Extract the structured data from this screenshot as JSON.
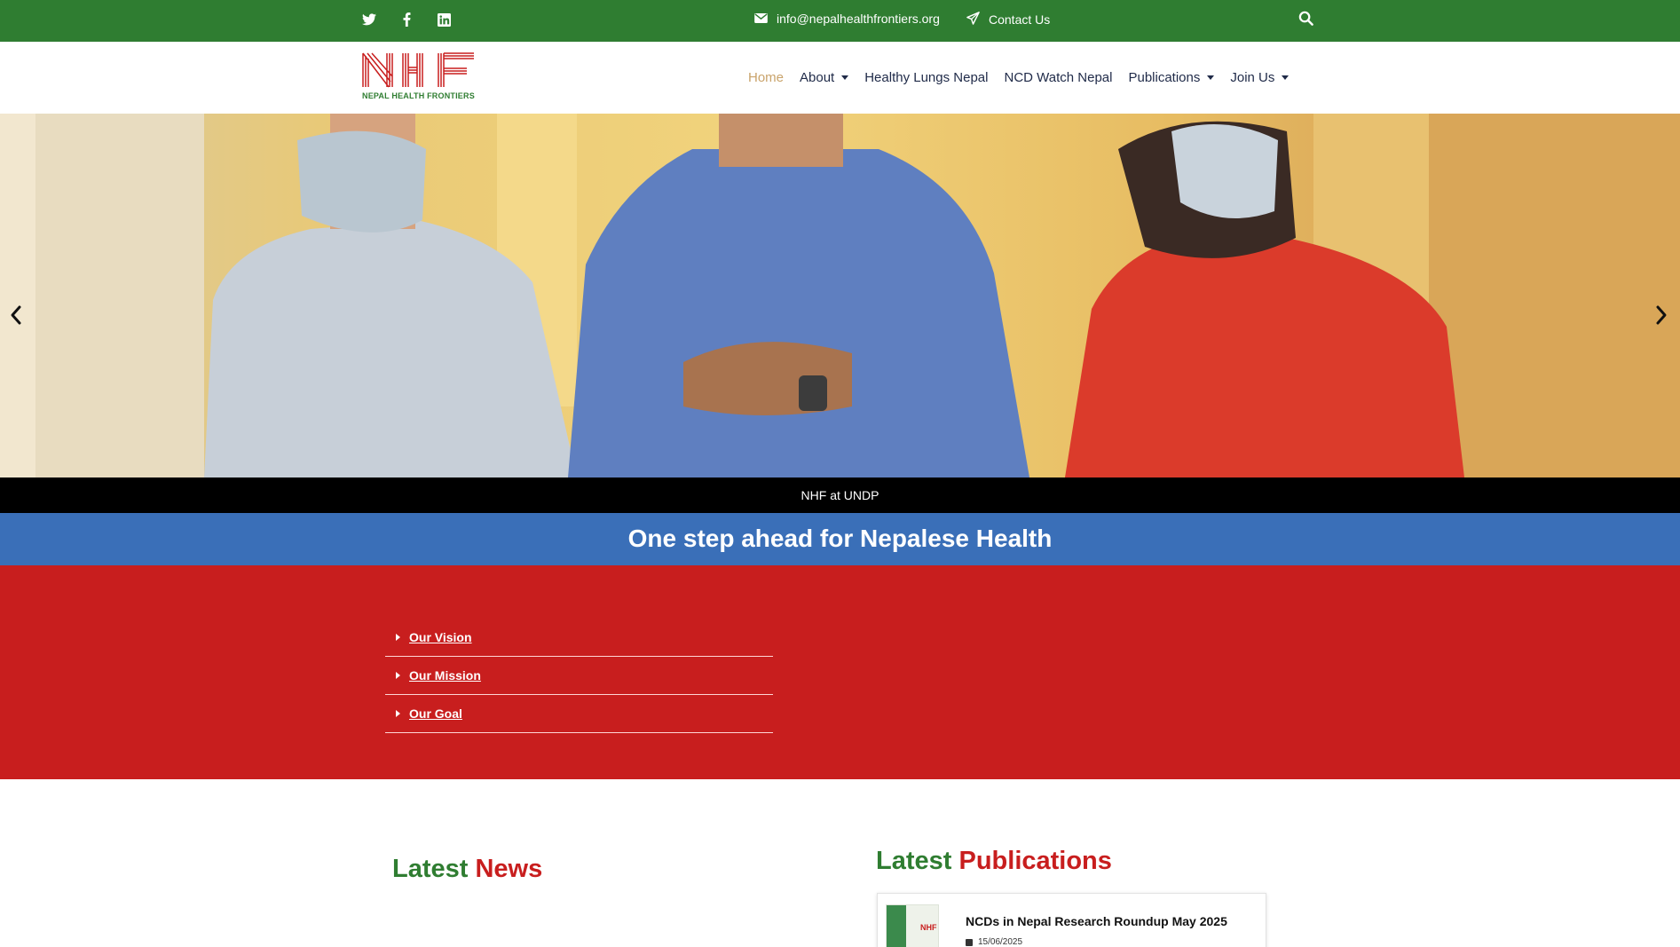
{
  "topbar": {
    "social": [
      "twitter-icon",
      "facebook-icon",
      "linkedin-icon"
    ],
    "email": "info@nepalhealthfrontiers.org",
    "contact_label": "Contact Us"
  },
  "header": {
    "logo_text": "NHF",
    "logo_subtitle": "NEPAL HEALTH FRONTIERS",
    "nav": [
      {
        "label": "Home",
        "active": true
      },
      {
        "label": "About",
        "dropdown": true
      },
      {
        "label": "Healthy Lungs Nepal"
      },
      {
        "label": "NCD Watch Nepal"
      },
      {
        "label": "Publications",
        "dropdown": true
      },
      {
        "label": "Join Us",
        "dropdown": true
      }
    ]
  },
  "hero": {
    "caption": "NHF at UNDP"
  },
  "tagline": "One step ahead for Nepalese Health",
  "accordion": [
    {
      "label": "Our Vision"
    },
    {
      "label": "Our Mission"
    },
    {
      "label": "Our Goal"
    }
  ],
  "news": {
    "heading_part1": "Latest",
    "heading_part2": "News"
  },
  "publications": {
    "heading_part1": "Latest",
    "heading_part2": "Publications",
    "items": [
      {
        "title": "NCDs in Nepal Research Roundup May 2025",
        "date": "15/06/2025"
      }
    ]
  },
  "colors": {
    "topbar": "#2f7d31",
    "nav_active": "#c9a36b",
    "tagline_bar": "#3a6fb8",
    "red_section": "#c81e1e"
  }
}
